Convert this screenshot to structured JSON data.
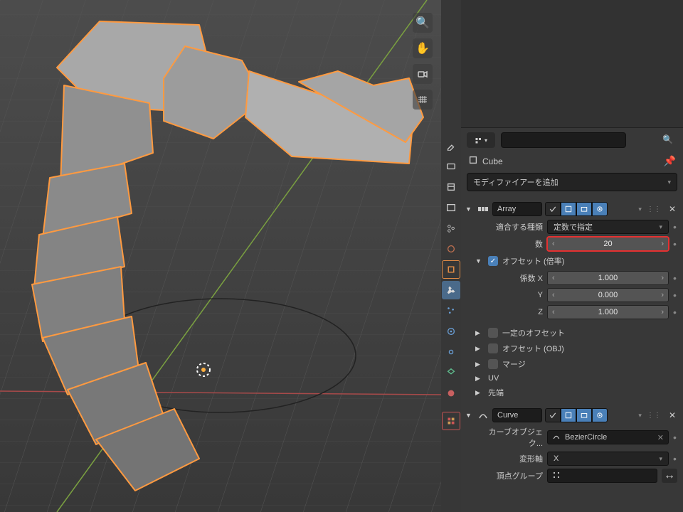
{
  "viewport": {
    "object_name": "Cube",
    "tools": [
      "zoom",
      "pan",
      "camera",
      "grid"
    ]
  },
  "search": {
    "placeholder": ""
  },
  "object_header": {
    "name": "Cube"
  },
  "add_modifier_label": "モディファイアーを追加",
  "array_mod": {
    "name": "Array",
    "fit_type_label": "適合する種類",
    "fit_type_value": "定数で指定",
    "count_label": "数",
    "count_value": "20",
    "offset_header": "オフセット (倍率)",
    "factor_x_label": "係数 X",
    "factor_x": "1.000",
    "y_label": "Y",
    "y": "0.000",
    "z_label": "Z",
    "z": "1.000",
    "sect_const_offset": "一定のオフセット",
    "sect_obj_offset": "オフセット (OBJ)",
    "sect_merge": "マージ",
    "sect_uv": "UV",
    "sect_caps": "先端"
  },
  "curve_mod": {
    "name": "Curve",
    "object_label": "カーブオブジェク...",
    "object_value": "BezierCircle",
    "axis_label": "変形軸",
    "axis_value": "X",
    "vgroup_label": "頂点グループ"
  }
}
